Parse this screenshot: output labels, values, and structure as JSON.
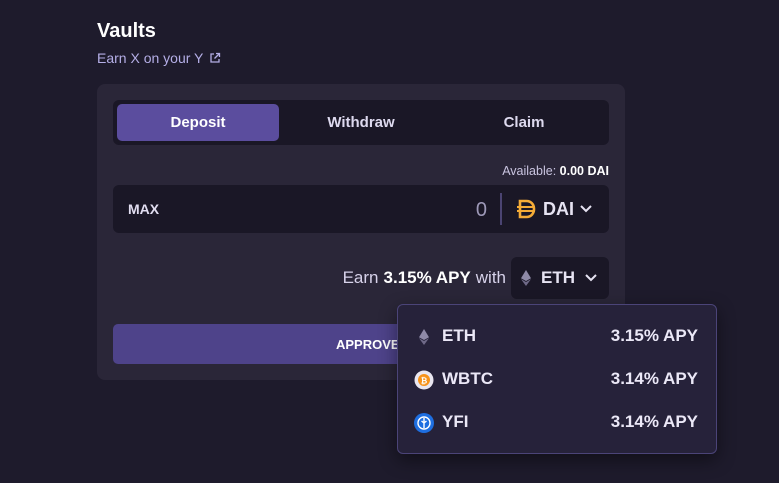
{
  "header": {
    "title": "Vaults",
    "subtitle": "Earn X on your Y"
  },
  "tabs": [
    {
      "label": "Deposit",
      "active": true
    },
    {
      "label": "Withdraw",
      "active": false
    },
    {
      "label": "Claim",
      "active": false
    }
  ],
  "available": {
    "label": "Available:",
    "value": "0.00 DAI"
  },
  "amount": {
    "max_label": "MAX",
    "placeholder": "0",
    "token": "DAI"
  },
  "earn": {
    "prefix": "Earn",
    "apy": "3.15% APY",
    "suffix": "with",
    "token": "ETH"
  },
  "approve_label": "APPROVE",
  "dropdown": [
    {
      "symbol": "ETH",
      "apy": "3.15% APY",
      "icon": "eth-icon"
    },
    {
      "symbol": "WBTC",
      "apy": "3.14% APY",
      "icon": "wbtc-icon"
    },
    {
      "symbol": "YFI",
      "apy": "3.14% APY",
      "icon": "yfi-icon"
    }
  ],
  "colors": {
    "background": "#1e1b2c",
    "card": "#2a2638",
    "accent": "#5b4d9e",
    "dai": "#f5ac37",
    "yfi": "#1e6ee0",
    "wbtc": "#f7931a"
  }
}
